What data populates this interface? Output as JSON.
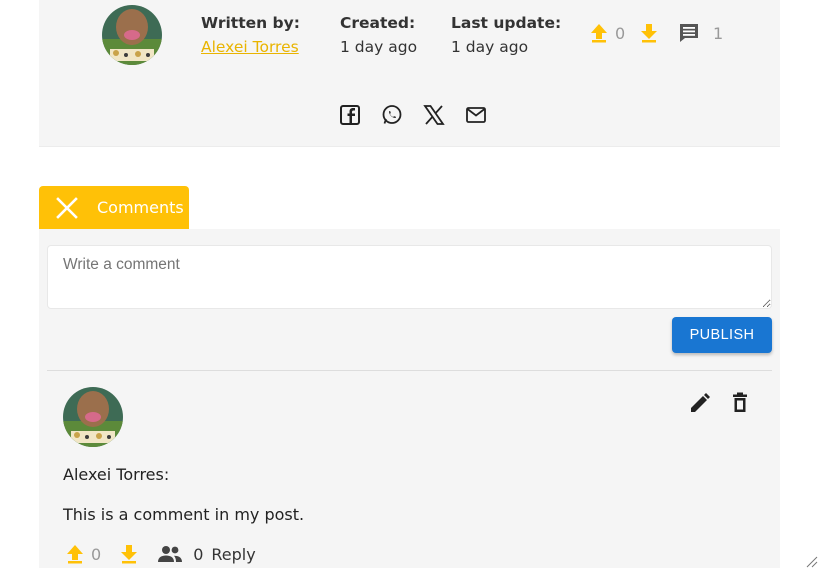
{
  "post": {
    "written_by_label": "Written by:",
    "author_name": "Alexei Torres",
    "created_label": "Created:",
    "created_value": "1 day ago",
    "updated_label": "Last update:",
    "updated_value": "1 day ago",
    "upvotes": "0",
    "comments_count": "1",
    "accent_color": "#ffc107",
    "icons": [
      "upvote-icon",
      "download-icon",
      "comment-icon",
      "facebook-icon",
      "whatsapp-icon",
      "x-icon",
      "email-icon"
    ]
  },
  "comments": {
    "tab_label": "Comments",
    "input_placeholder": "Write a comment",
    "publish_label": "PUBLISH",
    "items": [
      {
        "author": "Alexei Torres:",
        "text": "This is a comment in my post.",
        "upvotes": "0",
        "followers": "0",
        "reply_label": "Reply"
      }
    ]
  }
}
